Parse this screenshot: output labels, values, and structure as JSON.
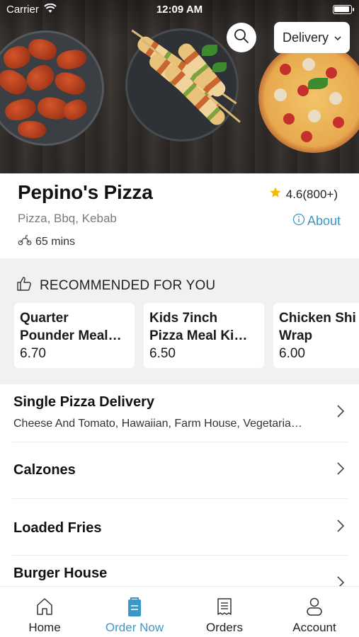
{
  "status_bar": {
    "carrier": "Carrier",
    "time": "12:09 AM"
  },
  "header": {
    "delivery_mode": "Delivery",
    "search_icon": "search-icon",
    "dropdown_icon": "chevron-down-icon"
  },
  "restaurant": {
    "name": "Pepino's Pizza",
    "rating": "4.6(800+)",
    "cuisines": "Pizza, Bbq, Kebab",
    "about_label": "About",
    "delivery_time": "65 mins",
    "star_color": "#f5b800",
    "accent_color": "#3a98c8"
  },
  "recommended": {
    "heading": "RECOMMENDED FOR YOU",
    "items": [
      {
        "name_line1": "Quarter",
        "name_line2": "Pounder Meal…",
        "price": "6.70"
      },
      {
        "name_line1": "Kids 7inch",
        "name_line2": "Pizza Meal Ki…",
        "price": "6.50"
      },
      {
        "name_line1": "Chicken Shi",
        "name_line2": "Wrap",
        "price": "6.00"
      }
    ]
  },
  "categories": [
    {
      "title": "Single Pizza Delivery",
      "subtitle": "Cheese And Tomato, Hawaiian, Farm House, Vegetaria…"
    },
    {
      "title": "Calzones",
      "subtitle": ""
    },
    {
      "title": "Loaded Fries",
      "subtitle": ""
    },
    {
      "title": "Burger House",
      "subtitle": ""
    }
  ],
  "tabs": [
    {
      "label": "Home",
      "icon": "home-icon",
      "active": false
    },
    {
      "label": "Order Now",
      "icon": "order-bag-icon",
      "active": true
    },
    {
      "label": "Orders",
      "icon": "receipt-icon",
      "active": false
    },
    {
      "label": "Account",
      "icon": "person-icon",
      "active": false
    }
  ]
}
